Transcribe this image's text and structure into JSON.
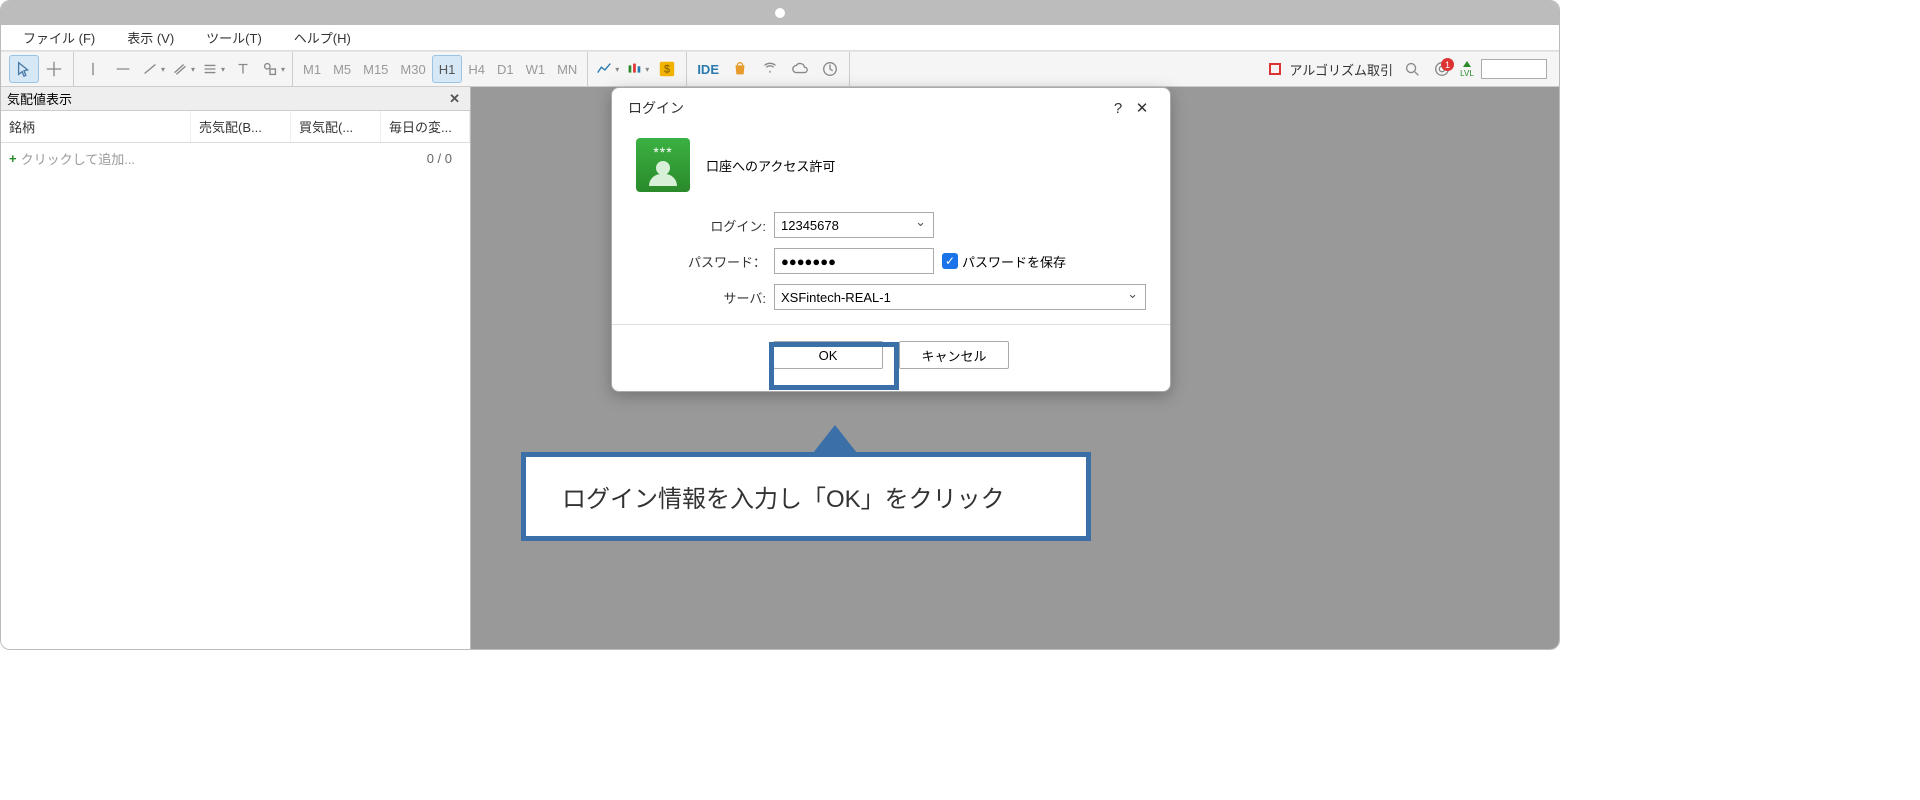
{
  "menu": {
    "file": "ファイル (F)",
    "view": "表示 (V)",
    "tools": "ツール(T)",
    "help": "ヘルプ(H)"
  },
  "timeframes": {
    "m1": "M1",
    "m5": "M5",
    "m15": "M15",
    "m30": "M30",
    "h1": "H1",
    "h4": "H4",
    "d1": "D1",
    "w1": "W1",
    "mn": "MN"
  },
  "toolbar": {
    "ide": "IDE",
    "algo": "アルゴリズム取引",
    "lvl": "LVL",
    "badge": "1"
  },
  "panel": {
    "title": "気配値表示",
    "cols": {
      "symbol": "銘柄",
      "ask": "売気配(B...",
      "bid": "買気配(...",
      "daily": "毎日の変..."
    },
    "add": "クリックして追加...",
    "daily_value": "0 / 0"
  },
  "dialog": {
    "title": "ログイン",
    "access": "口座へのアクセス許可",
    "login_label": "ログイン:",
    "login_value": "12345678",
    "password_label": "パスワード：",
    "password_value": "●●●●●●●",
    "save_pwd": "パスワードを保存",
    "server_label": "サーバ:",
    "server_value": "XSFintech-REAL-1",
    "ok": "OK",
    "cancel": "キャンセル"
  },
  "callout": {
    "text": "ログイン情報を入力し「OK」をクリック"
  }
}
